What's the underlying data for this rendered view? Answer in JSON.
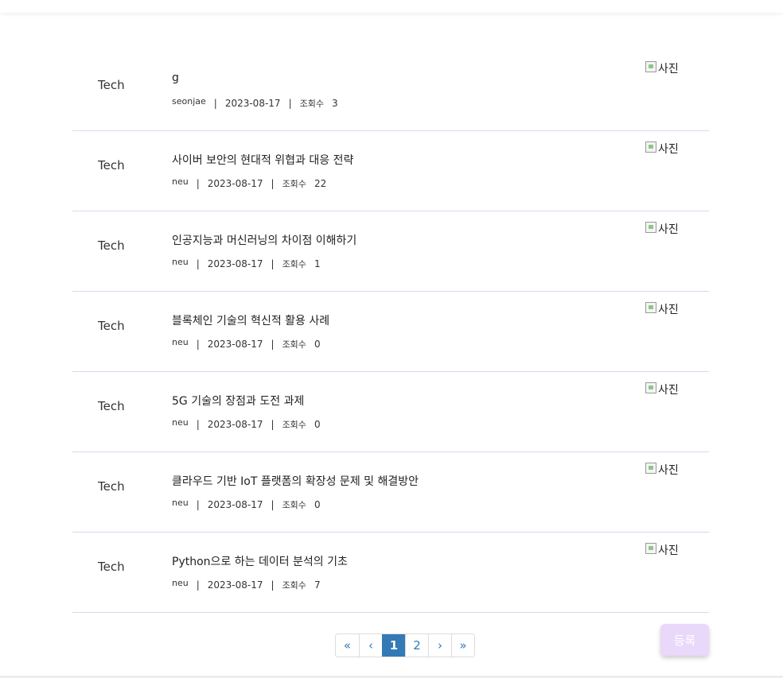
{
  "posts": [
    {
      "category": "Tech",
      "title": "g",
      "author": "seonjae",
      "date": "2023-08-17",
      "views_label": "조회수",
      "views": "3",
      "thumb_alt": "사진"
    },
    {
      "category": "Tech",
      "title": "사이버 보안의 현대적 위협과 대응 전략",
      "author": "neu",
      "date": "2023-08-17",
      "views_label": "조회수",
      "views": "22",
      "thumb_alt": "사진"
    },
    {
      "category": "Tech",
      "title": "인공지능과 머신러닝의 차이점 이해하기",
      "author": "neu",
      "date": "2023-08-17",
      "views_label": "조회수",
      "views": "1",
      "thumb_alt": "사진"
    },
    {
      "category": "Tech",
      "title": "블록체인 기술의 혁신적 활용 사례",
      "author": "neu",
      "date": "2023-08-17",
      "views_label": "조회수",
      "views": "0",
      "thumb_alt": "사진"
    },
    {
      "category": "Tech",
      "title": "5G 기술의 장점과 도전 과제",
      "author": "neu",
      "date": "2023-08-17",
      "views_label": "조회수",
      "views": "0",
      "thumb_alt": "사진"
    },
    {
      "category": "Tech",
      "title": "클라우드 기반 IoT 플랫폼의 확장성 문제 및 해결방안",
      "author": "neu",
      "date": "2023-08-17",
      "views_label": "조회수",
      "views": "0",
      "thumb_alt": "사진"
    },
    {
      "category": "Tech",
      "title": "Python으로 하는 데이터 분석의 기초",
      "author": "neu",
      "date": "2023-08-17",
      "views_label": "조회수",
      "views": "7",
      "thumb_alt": "사진"
    }
  ],
  "meta_separator": "|",
  "pagination": {
    "first": "«",
    "prev": "‹",
    "pages": [
      "1",
      "2"
    ],
    "active_page": "1",
    "next": "›",
    "last": "»"
  },
  "register_button": "등록",
  "colors": {
    "accent": "#337ab7",
    "register_bg": "#ead8fb",
    "row_divider": "#dcd6ee"
  }
}
